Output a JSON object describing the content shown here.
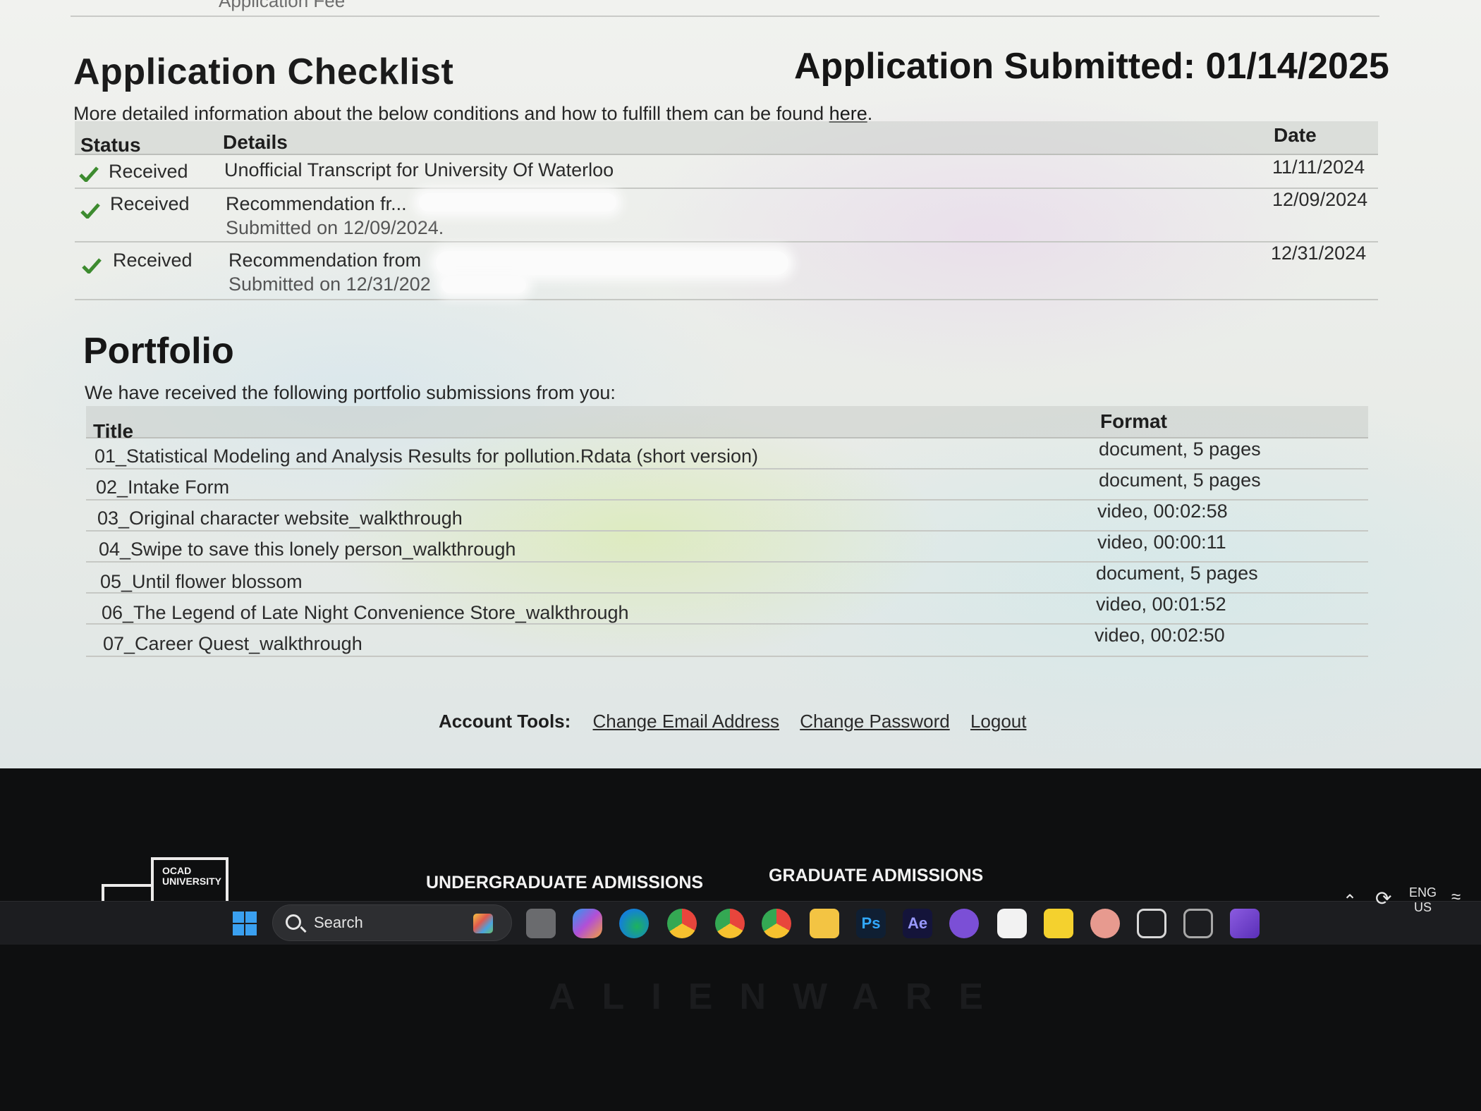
{
  "header": {
    "previous_item": "Application Fee",
    "checklist_title": "Application Checklist",
    "submitted": "Application Submitted: 01/14/2025",
    "intro_text": "More detailed information about the below conditions and how to fulfill them can be found ",
    "intro_link": "here",
    "intro_end": "."
  },
  "checklist": {
    "columns": {
      "status": "Status",
      "details": "Details",
      "date": "Date"
    },
    "rows": [
      {
        "status": "Received",
        "details": "Unofficial Transcript for University Of Waterloo",
        "sub": "",
        "date": "11/11/2024"
      },
      {
        "status": "Received",
        "details": "Recommendation fr...",
        "sub": "Submitted on 12/09/2024.",
        "date": "12/09/2024"
      },
      {
        "status": "Received",
        "details": "Recommendation from",
        "sub": "Submitted on 12/31/202",
        "date": "12/31/2024"
      }
    ]
  },
  "portfolio": {
    "title": "Portfolio",
    "intro": "We have received the following portfolio submissions from you:",
    "columns": {
      "title": "Title",
      "format": "Format"
    },
    "rows": [
      {
        "title": "01_Statistical Modeling and Analysis Results for pollution.Rdata (short version)",
        "format": "document, 5 pages"
      },
      {
        "title": "02_Intake Form",
        "format": "document, 5 pages"
      },
      {
        "title": "03_Original character website_walkthrough",
        "format": "video, 00:02:58"
      },
      {
        "title": "04_Swipe to save this lonely person_walkthrough",
        "format": "video, 00:00:11"
      },
      {
        "title": "05_Until flower blossom",
        "format": "document, 5 pages"
      },
      {
        "title": "06_The Legend of Late Night Convenience Store_walkthrough",
        "format": "video, 00:01:52"
      },
      {
        "title": "07_Career Quest_walkthrough",
        "format": "video, 00:02:50"
      }
    ]
  },
  "account_tools": {
    "label": "Account Tools:",
    "links": [
      "Change Email Address",
      "Change Password",
      "Logout"
    ]
  },
  "footer": {
    "logo_text": "OCAD UNIVERSITY",
    "logo_fragment": "O C",
    "undergrad": "UNDERGRADUATE ADMISSIONS",
    "grad": "GRADUATE ADMISSIONS"
  },
  "taskbar": {
    "search_placeholder": "Search",
    "icons": [
      "windows-start",
      "task-view",
      "copilot",
      "edge",
      "chrome",
      "chrome-profile-2",
      "chrome-profile-3",
      "file-explorer",
      "photoshop",
      "after-effects",
      "github-desktop",
      "lens-app",
      "sticky-notes",
      "game-app",
      "unity-hub",
      "unity-hub-2",
      "visual-studio"
    ],
    "lang_line1": "ENG",
    "lang_line2": "US"
  },
  "monitor_brand": "ALIENWARE",
  "colors": {
    "check_green": "#3d8b2f",
    "taskbar_bg": "#1c1d20",
    "screen_bg": "#eceeea"
  }
}
